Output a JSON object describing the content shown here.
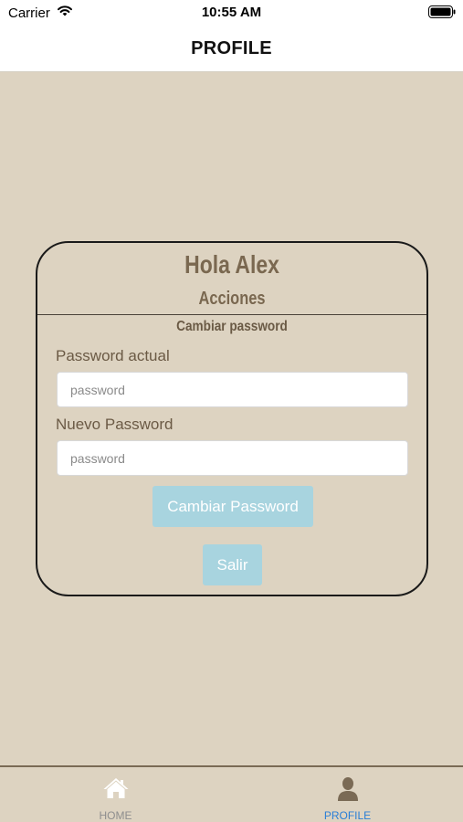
{
  "status_bar": {
    "carrier": "Carrier",
    "time": "10:55 AM"
  },
  "nav": {
    "title": "PROFILE"
  },
  "card": {
    "greeting": "Hola Alex",
    "actions_title": "Acciones",
    "section_title": "Cambiar password",
    "current_password": {
      "label": "Password actual",
      "placeholder": "password",
      "value": ""
    },
    "new_password": {
      "label": "Nuevo Password",
      "placeholder": "password",
      "value": ""
    },
    "change_button": "Cambiar Password",
    "exit_button": "Salir"
  },
  "tab_bar": {
    "tabs": [
      {
        "label": "HOME",
        "icon": "home-icon",
        "active": false
      },
      {
        "label": "PROFILE",
        "icon": "user-icon",
        "active": true
      }
    ],
    "active_color": "#2a7fd6",
    "inactive_color": "#8e8e8e"
  },
  "colors": {
    "background": "#ddd3c1",
    "heading": "#7a6850",
    "button": "#a8d4df"
  }
}
